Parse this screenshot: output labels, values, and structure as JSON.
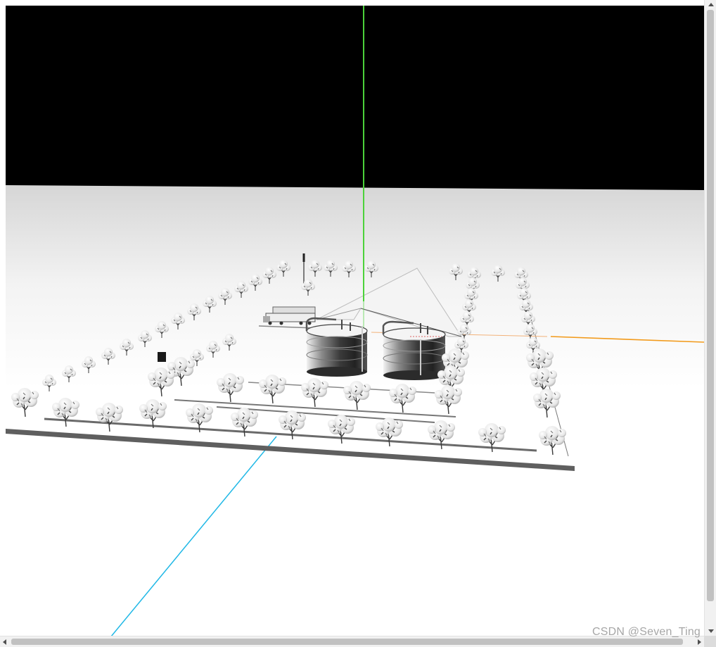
{
  "watermark": {
    "text": "CSDN @Seven_Ting"
  },
  "scene": {
    "description_colors": {
      "sky": "#000000",
      "ground_far": "#d9d9d9",
      "ground_near": "#ffffff",
      "axis_y": "#33e033",
      "axis_x": "#f29a1a",
      "axis_z": "#20b8e6",
      "border": "#5a5a5a",
      "tank_dark": "#2f2f2f",
      "tree_leaf": "#e8e8e8",
      "tree_trunk": "#3a3a3a"
    }
  },
  "icons": {
    "scroll_up": "arrow-up-icon",
    "scroll_down": "arrow-down-icon",
    "scroll_left": "arrow-left-icon",
    "scroll_right": "arrow-right-icon"
  }
}
